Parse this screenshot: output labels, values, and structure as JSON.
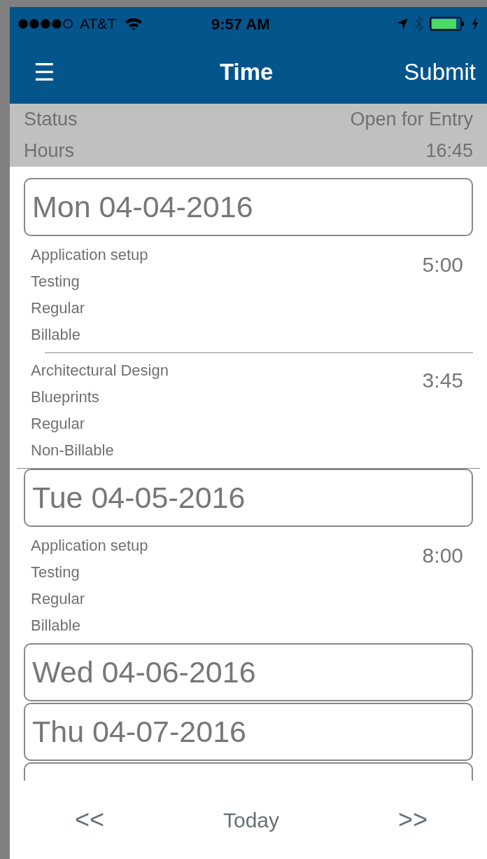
{
  "status_bar": {
    "carrier": "AT&T",
    "time": "9:57 AM"
  },
  "nav": {
    "menu": "☰",
    "title": "Time",
    "action": "Submit"
  },
  "summary": [
    {
      "label": "Status",
      "value": "Open for Entry"
    },
    {
      "label": "Hours",
      "value": "16:45"
    }
  ],
  "days": [
    {
      "label": "Mon 04-04-2016",
      "entries": [
        {
          "lines": [
            "Application setup",
            "Testing",
            "Regular",
            "Billable"
          ],
          "time": "5:00"
        },
        {
          "lines": [
            "Architectural Design",
            "Blueprints",
            "Regular",
            "Non-Billable"
          ],
          "time": "3:45"
        }
      ]
    },
    {
      "label": "Tue 04-05-2016",
      "entries": [
        {
          "lines": [
            "Application setup",
            "Testing",
            "Regular",
            "Billable"
          ],
          "time": "8:00"
        }
      ]
    },
    {
      "label": "Wed 04-06-2016"
    },
    {
      "label": "Thu 04-07-2016"
    }
  ],
  "footer": {
    "previous": "<<",
    "today": "Today",
    "next": ">>"
  }
}
